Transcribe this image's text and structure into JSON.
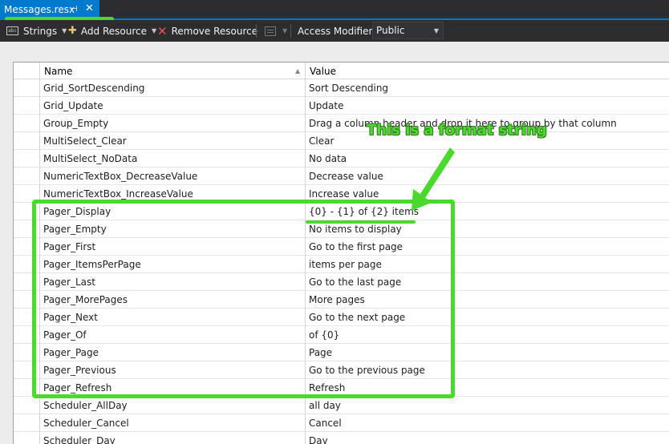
{
  "tab": {
    "title": "Messages.resx",
    "pin_glyph": "⊣",
    "close_glyph": "✕"
  },
  "toolbar": {
    "strings_icon": "abc",
    "strings_label": "Strings",
    "add_label": "Add Resource",
    "remove_label": "Remove Resource",
    "access_modifier_label": "Access Modifier:",
    "access_modifier_value": "Public"
  },
  "grid": {
    "columns": [
      "Name",
      "Value"
    ],
    "rows": [
      {
        "name": "Grid_SortDescending",
        "value": "Sort Descending"
      },
      {
        "name": "Grid_Update",
        "value": "Update"
      },
      {
        "name": "Group_Empty",
        "value": "Drag a column header and drop it here to group by that column"
      },
      {
        "name": "MultiSelect_Clear",
        "value": "Clear"
      },
      {
        "name": "MultiSelect_NoData",
        "value": "No data"
      },
      {
        "name": "NumericTextBox_DecreaseValue",
        "value": "Decrease value"
      },
      {
        "name": "NumericTextBox_IncreaseValue",
        "value": "Increase value"
      },
      {
        "name": "Pager_Display",
        "value": "{0} - {1} of {2} items"
      },
      {
        "name": "Pager_Empty",
        "value": "No items to display"
      },
      {
        "name": "Pager_First",
        "value": "Go to the first page"
      },
      {
        "name": "Pager_ItemsPerPage",
        "value": "items per page"
      },
      {
        "name": "Pager_Last",
        "value": "Go to the last page"
      },
      {
        "name": "Pager_MorePages",
        "value": "More pages"
      },
      {
        "name": "Pager_Next",
        "value": "Go to the next page"
      },
      {
        "name": "Pager_Of",
        "value": "of {0}"
      },
      {
        "name": "Pager_Page",
        "value": "Page"
      },
      {
        "name": "Pager_Previous",
        "value": "Go to the previous page"
      },
      {
        "name": "Pager_Refresh",
        "value": "Refresh"
      },
      {
        "name": "Scheduler_AllDay",
        "value": "all day"
      },
      {
        "name": "Scheduler_Cancel",
        "value": "Cancel"
      },
      {
        "name": "Scheduler_Day",
        "value": "Day"
      }
    ]
  },
  "annotation": {
    "text": "This is  a format string",
    "color": "#4ad92c"
  },
  "colors": {
    "accent": "#007acc",
    "toolbar_bg": "#2d2d30",
    "annotation": "#4ad92c"
  }
}
